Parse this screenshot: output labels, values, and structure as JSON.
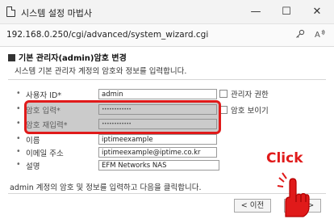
{
  "window": {
    "title": "시스템 설정 마법사",
    "controls": {
      "minimize": "—",
      "maximize": "☐",
      "close": "✕"
    }
  },
  "address": {
    "url": "192.168.0.250/cgi/advanced/system_wizard.cgi",
    "icons": [
      "key-icon",
      "read-aloud-icon"
    ]
  },
  "section": {
    "title": "기본 관리자(admin)암호 변경",
    "description": "시스템 기본 관리자 계정의 암호와 정보를 입력합니다."
  },
  "form": {
    "user_id_label": "사용자 ID*",
    "user_id_value": "admin",
    "password_label": "암호 입력*",
    "password_value": "••••••••••••",
    "password_confirm_label": "암호 재입력*",
    "password_confirm_value": "••••••••••••",
    "name_label": "이름",
    "name_value": "iptimeexample",
    "email_label": "이메일 주소",
    "email_value": "iptimeexample@iptime.co.kr",
    "desc_label": "설명",
    "desc_value": "EFM Networks NAS",
    "admin_rights_label": "관리자 권한",
    "show_password_label": "암호 보이기"
  },
  "footer": {
    "note": "admin 계정의 암호 및 정보를 입력하고 다음을 클릭합니다.",
    "prev_label": "< 이전",
    "next_label": "다음 >"
  },
  "annotation": {
    "callout_text": "Click",
    "highlight_color": "#e01a1a"
  }
}
